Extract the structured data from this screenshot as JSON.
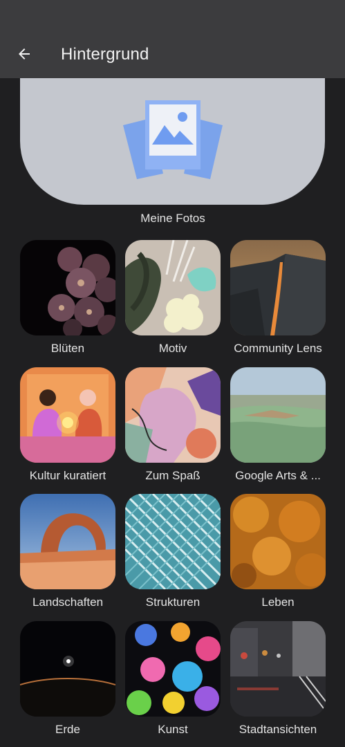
{
  "app_bar": {
    "title": "Hintergrund",
    "back_icon": "arrow-left-icon"
  },
  "my_photos": {
    "label": "Meine Fotos",
    "icon": "photos-stack-icon"
  },
  "categories": [
    {
      "label": "Blüten"
    },
    {
      "label": "Motiv"
    },
    {
      "label": "Community Lens"
    },
    {
      "label": "Kultur kuratiert"
    },
    {
      "label": "Zum Spaß"
    },
    {
      "label": "Google Arts & ..."
    },
    {
      "label": "Landschaften"
    },
    {
      "label": "Strukturen"
    },
    {
      "label": "Leben"
    },
    {
      "label": "Erde"
    },
    {
      "label": "Kunst"
    },
    {
      "label": "Stadtansichten"
    }
  ],
  "colors": {
    "background": "#1f1f21",
    "app_bar": "#3c3c3e",
    "my_photos_card": "#c4c7ce",
    "icon_blue": "#6f9cf0"
  }
}
